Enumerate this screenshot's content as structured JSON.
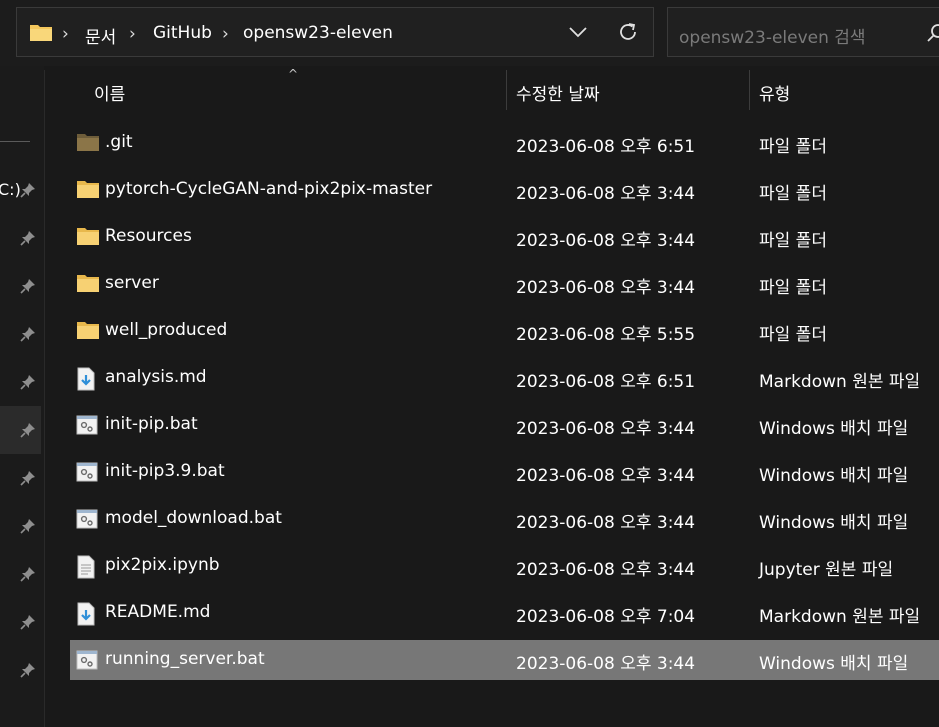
{
  "address_bar": {
    "breadcrumbs": [
      "문서",
      "GitHub",
      "opensw23-eleven"
    ]
  },
  "search": {
    "placeholder": "opensw23-eleven 검색"
  },
  "nav": {
    "partial_label": "C:)"
  },
  "columns": {
    "name": "이름",
    "date": "수정한 날짜",
    "type": "유형"
  },
  "files": [
    {
      "name": ".git",
      "date": "2023-06-08 오후 6:51",
      "type": "파일 폴더",
      "icon": "folder-dark-icon"
    },
    {
      "name": "pytorch-CycleGAN-and-pix2pix-master",
      "date": "2023-06-08 오후 3:44",
      "type": "파일 폴더",
      "icon": "folder-icon"
    },
    {
      "name": "Resources",
      "date": "2023-06-08 오후 3:44",
      "type": "파일 폴더",
      "icon": "folder-icon"
    },
    {
      "name": "server",
      "date": "2023-06-08 오후 3:44",
      "type": "파일 폴더",
      "icon": "folder-icon"
    },
    {
      "name": "well_produced",
      "date": "2023-06-08 오후 5:55",
      "type": "파일 폴더",
      "icon": "folder-icon"
    },
    {
      "name": "analysis.md",
      "date": "2023-06-08 오후 6:51",
      "type": "Markdown 원본 파일",
      "icon": "markdown-file-icon"
    },
    {
      "name": "init-pip.bat",
      "date": "2023-06-08 오후 3:44",
      "type": "Windows 배치 파일",
      "icon": "batch-file-icon"
    },
    {
      "name": "init-pip3.9.bat",
      "date": "2023-06-08 오후 3:44",
      "type": "Windows 배치 파일",
      "icon": "batch-file-icon"
    },
    {
      "name": "model_download.bat",
      "date": "2023-06-08 오후 3:44",
      "type": "Windows 배치 파일",
      "icon": "batch-file-icon"
    },
    {
      "name": "pix2pix.ipynb",
      "date": "2023-06-08 오후 3:44",
      "type": "Jupyter 원본 파일",
      "icon": "text-file-icon"
    },
    {
      "name": "README.md",
      "date": "2023-06-08 오후 7:04",
      "type": "Markdown 원본 파일",
      "icon": "markdown-file-icon"
    },
    {
      "name": "running_server.bat",
      "date": "2023-06-08 오후 3:44",
      "type": "Windows 배치 파일",
      "icon": "batch-file-icon",
      "selected": true
    }
  ],
  "colors": {
    "background": "#191919",
    "selected_row": "#777777",
    "folder": "#f4c75c",
    "git_folder": "#8b7548",
    "markdown_arrow": "#2f8fd8"
  }
}
